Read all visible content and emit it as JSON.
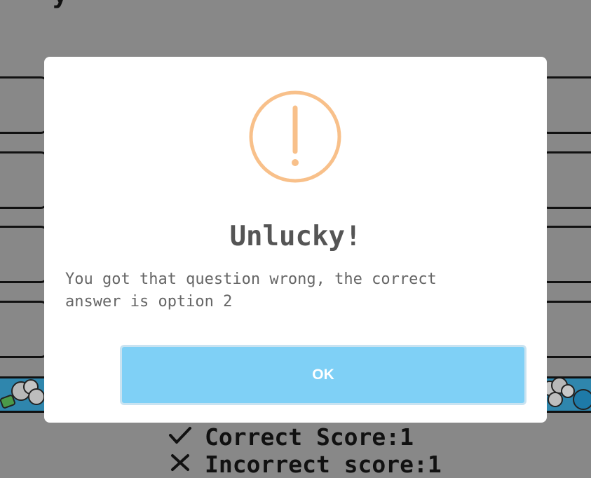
{
  "modal": {
    "title": "Unlucky!",
    "message": "You got that question wrong, the correct answer is option 2",
    "ok_label": "OK",
    "icon": "warning-icon",
    "icon_color": "#f8c08a",
    "button_color": "#7fd0f6"
  },
  "scores": {
    "correct_label": "Correct Score:1",
    "incorrect_label": "Incorrect score:1"
  },
  "colors": {
    "overlay": "#888888"
  }
}
